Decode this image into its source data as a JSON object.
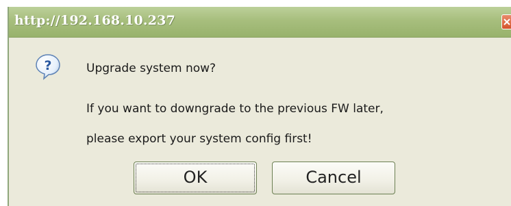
{
  "dialog": {
    "title": "http://192.168.10.237",
    "close_icon": "close-icon",
    "question_icon": "question-icon",
    "message": {
      "line1": "Upgrade system now?",
      "line2": "If you want to downgrade to the previous FW later,",
      "line3": "please export your system config first!"
    },
    "buttons": {
      "ok_label": "OK",
      "cancel_label": "Cancel"
    },
    "colors": {
      "titlebar": "#a7be7d",
      "body": "#ebeadb",
      "close": "#d4542c"
    }
  }
}
